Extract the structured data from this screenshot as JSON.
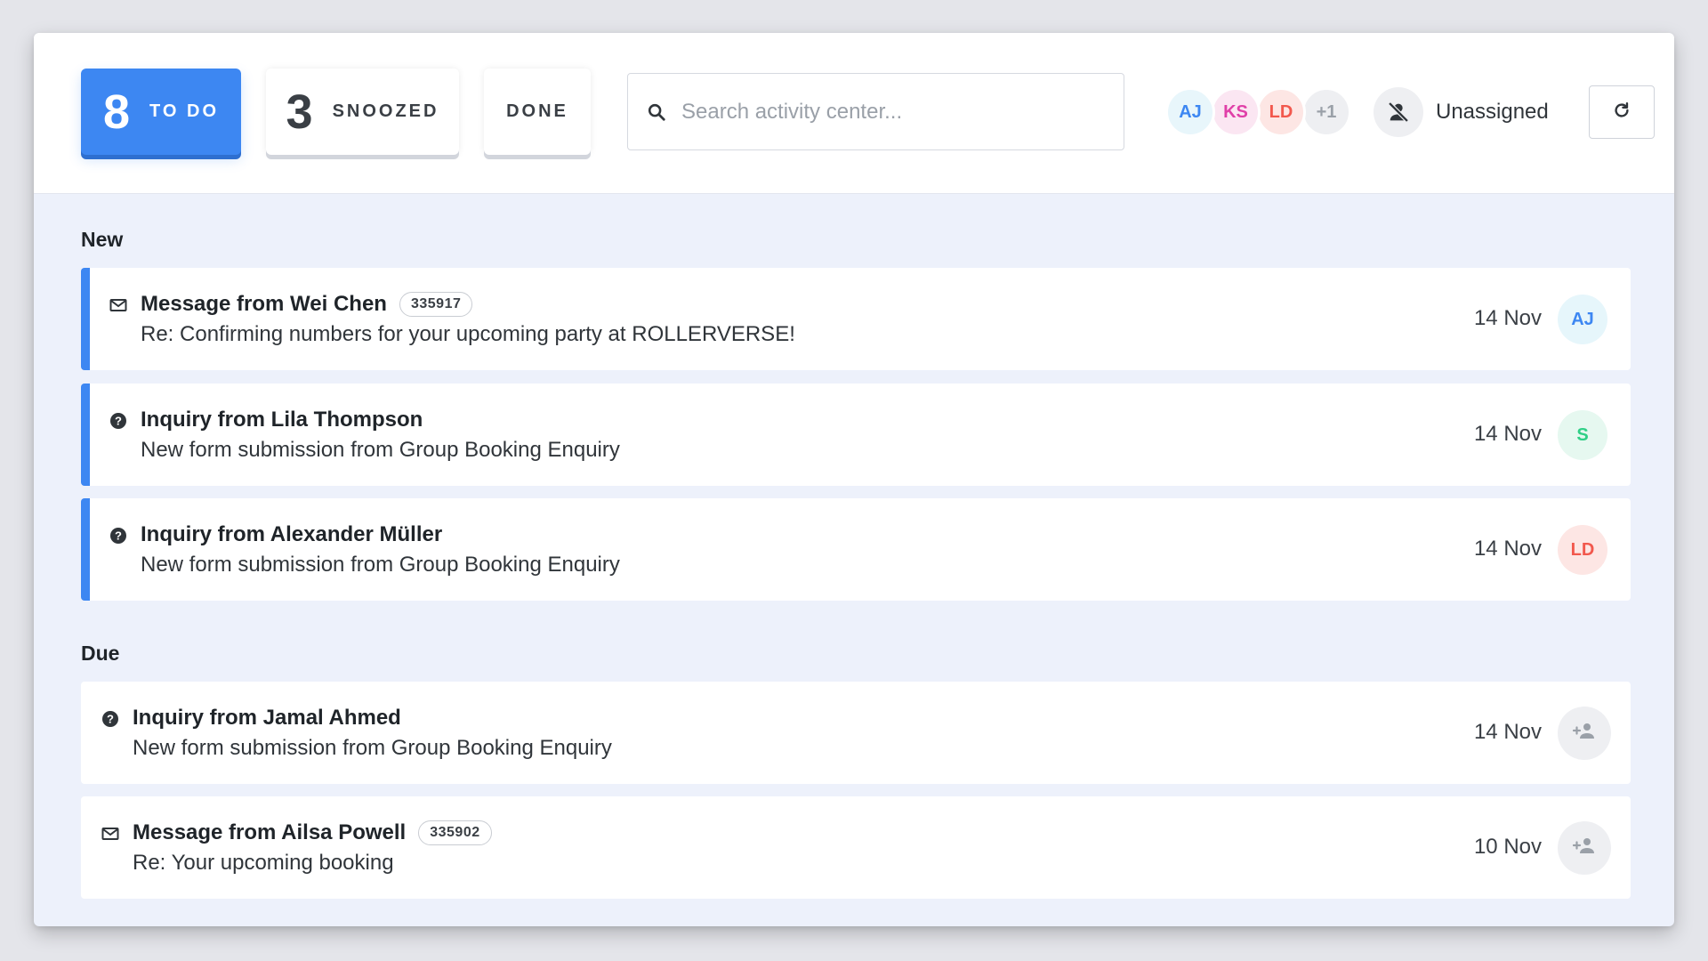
{
  "tabs": {
    "todo": {
      "count": "8",
      "label": "TO DO"
    },
    "snoozed": {
      "count": "3",
      "label": "SNOOZED"
    },
    "done": {
      "label": "DONE"
    }
  },
  "search": {
    "placeholder": "Search activity center...",
    "value": ""
  },
  "assignees": [
    {
      "initials": "AJ",
      "color": "#3d87f2",
      "bg": "#e8f6fb"
    },
    {
      "initials": "KS",
      "color": "#e03fa8",
      "bg": "#fbe6f2"
    },
    {
      "initials": "LD",
      "color": "#f2584d",
      "bg": "#fde6e4"
    },
    {
      "initials": "+1",
      "color": "#9aa0a8",
      "bg": "#eeeff2"
    }
  ],
  "unassigned_label": "Unassigned",
  "sections": [
    {
      "title": "New",
      "items": [
        {
          "type": "message",
          "title": "Message from Wei Chen",
          "ref": "335917",
          "subtitle": "Re: Confirming numbers for your upcoming party at ROLLERVERSE!",
          "date": "14 Nov",
          "assignee": {
            "initials": "AJ",
            "color": "#3d87f2",
            "bg": "#e6f6fb"
          }
        },
        {
          "type": "inquiry",
          "title": "Inquiry from Lila Thompson",
          "ref": "",
          "subtitle": "New form submission from Group Booking Enquiry",
          "date": "14 Nov",
          "assignee": {
            "initials": "S",
            "color": "#2fcf86",
            "bg": "#e6f8f0"
          }
        },
        {
          "type": "inquiry",
          "title": "Inquiry from Alexander Müller",
          "ref": "",
          "subtitle": "New form submission from Group Booking Enquiry",
          "date": "14 Nov",
          "assignee": {
            "initials": "LD",
            "color": "#f2584d",
            "bg": "#fde6e4"
          }
        }
      ]
    },
    {
      "title": "Due",
      "items": [
        {
          "type": "inquiry",
          "title": "Inquiry from Jamal Ahmed",
          "ref": "",
          "subtitle": "New form submission from Group Booking Enquiry",
          "date": "14 Nov",
          "assignee": null
        },
        {
          "type": "message",
          "title": "Message from Ailsa Powell",
          "ref": "335902",
          "subtitle": "Re: Your upcoming booking",
          "date": "10 Nov",
          "assignee": null
        }
      ]
    }
  ],
  "icons": {
    "message": "envelope-icon",
    "inquiry": "question-circle-icon",
    "search": "search-icon",
    "unassigned": "person-off-icon",
    "refresh": "refresh-icon",
    "assign": "add-person-icon"
  }
}
